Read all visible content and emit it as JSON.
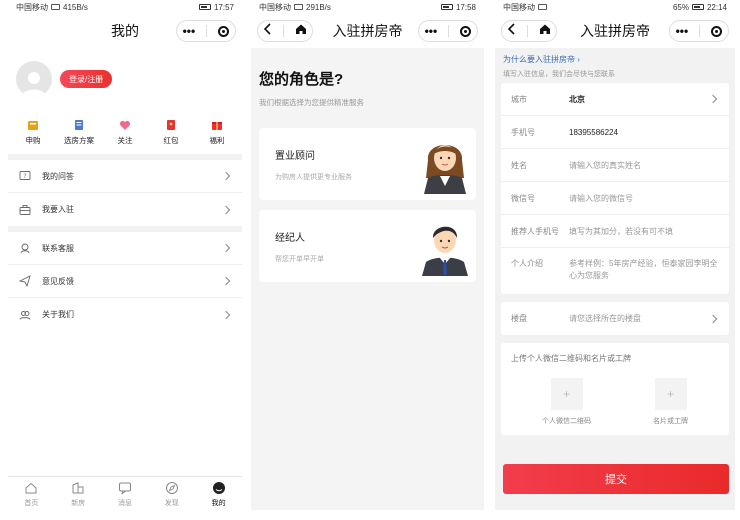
{
  "screen1": {
    "status": {
      "carrier": "中国移动",
      "speed": "415B/s",
      "time": "17:57"
    },
    "title": "我的",
    "login_label": "登录/注册",
    "quick": [
      {
        "label": "申购",
        "icon": "ticket-icon",
        "color": "#e3a21a"
      },
      {
        "label": "选房方案",
        "icon": "document-icon",
        "color": "#4a7ad8"
      },
      {
        "label": "关注",
        "icon": "heart-icon",
        "color": "#f06c8c"
      },
      {
        "label": "红包",
        "icon": "red-envelope-icon",
        "color": "#e83232"
      },
      {
        "label": "福利",
        "icon": "gift-icon",
        "color": "#e83232"
      }
    ],
    "menu_group1": [
      {
        "label": "我的问答",
        "icon": "question-icon"
      },
      {
        "label": "我要入驻",
        "icon": "briefcase-icon"
      }
    ],
    "menu_group2": [
      {
        "label": "联系客服",
        "icon": "headset-icon"
      },
      {
        "label": "意见反馈",
        "icon": "send-icon"
      },
      {
        "label": "关于我们",
        "icon": "people-icon"
      }
    ],
    "tabs": [
      {
        "label": "首页",
        "icon": "home-icon"
      },
      {
        "label": "新房",
        "icon": "building-icon"
      },
      {
        "label": "消息",
        "icon": "message-icon"
      },
      {
        "label": "发现",
        "icon": "compass-icon"
      },
      {
        "label": "我的",
        "icon": "profile-icon"
      }
    ]
  },
  "screen2": {
    "status": {
      "carrier": "中国移动",
      "speed": "291B/s",
      "time": "17:58"
    },
    "title": "入驻拼房帝",
    "role_title": "您的角色是?",
    "role_sub": "我们根据选择为您提供精准服务",
    "roles": [
      {
        "name": "置业顾问",
        "desc": "为购房人提供更专业服务",
        "icon": "female-consultant-icon"
      },
      {
        "name": "经纪人",
        "desc": "帮您开单早开单",
        "icon": "male-agent-icon"
      }
    ]
  },
  "screen3": {
    "status": {
      "carrier": "中国移动",
      "battery": "65%",
      "time": "22:14"
    },
    "title": "入驻拼房帝",
    "why_link": "为什么要入驻拼房帝",
    "why_sub": "填写入驻信息，我们会尽快与您联系",
    "fields": {
      "city_label": "城市",
      "city_value": "北京",
      "phone_label": "手机号",
      "phone_value": "18395586224",
      "name_label": "姓名",
      "name_placeholder": "请输入您的真实姓名",
      "wechat_label": "微信号",
      "wechat_placeholder": "请输入您的微信号",
      "ref_label": "推荐人手机号",
      "ref_placeholder": "填写为其加分，若没有可不填",
      "intro_label": "个人介绍",
      "intro_placeholder": "参考样例：5年房产经验，恒泰家园李明全心为您服务"
    },
    "estate_label": "楼盘",
    "estate_placeholder": "请您选择所在的楼盘",
    "upload_title": "上传个人微信二维码和名片或工牌",
    "uploads": [
      {
        "label": "个人微信二维码"
      },
      {
        "label": "名片或工牌"
      }
    ],
    "submit": "提交",
    "accent": "#e92a2a"
  }
}
